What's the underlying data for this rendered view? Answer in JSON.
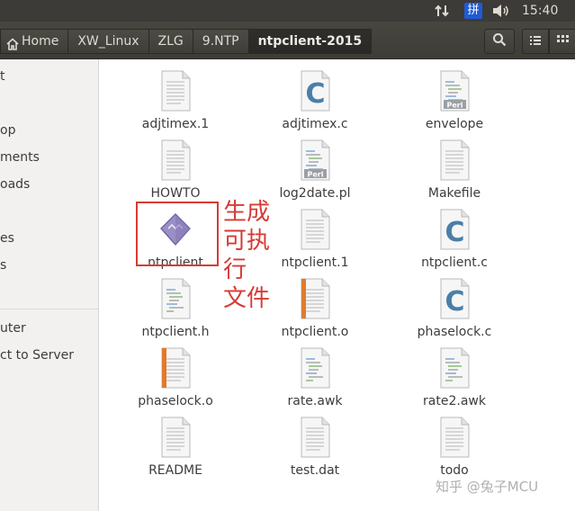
{
  "system_bar": {
    "keyboard_indicator": "拼",
    "time": "15:40"
  },
  "breadcrumb": {
    "items": [
      "Home",
      "XW_Linux",
      "ZLG",
      "9.NTP",
      "ntpclient-2015"
    ]
  },
  "sidebar": {
    "items": [
      "t",
      "op",
      "ments",
      "oads",
      "es",
      "s",
      "uter",
      "ct to Server"
    ]
  },
  "files": [
    {
      "name": "adjtimex.1",
      "type": "doc"
    },
    {
      "name": "adjtimex.c",
      "type": "c"
    },
    {
      "name": "envelope",
      "type": "perl"
    },
    {
      "name": "HOWTO",
      "type": "doc"
    },
    {
      "name": "log2date.pl",
      "type": "perl"
    },
    {
      "name": "Makefile",
      "type": "doc"
    },
    {
      "name": "ntpclient",
      "type": "exec"
    },
    {
      "name": "ntpclient.1",
      "type": "doc"
    },
    {
      "name": "ntpclient.c",
      "type": "c"
    },
    {
      "name": "ntpclient.h",
      "type": "header"
    },
    {
      "name": "ntpclient.o",
      "type": "object"
    },
    {
      "name": "phaselock.c",
      "type": "c"
    },
    {
      "name": "phaselock.o",
      "type": "object"
    },
    {
      "name": "rate.awk",
      "type": "script"
    },
    {
      "name": "rate2.awk",
      "type": "script"
    },
    {
      "name": "README",
      "type": "doc"
    },
    {
      "name": "test.dat",
      "type": "doc"
    },
    {
      "name": "todo",
      "type": "doc"
    }
  ],
  "annotation": {
    "text_line1": "生成",
    "text_line2": "可执行",
    "text_line3": "文件",
    "color": "#d63b36"
  },
  "watermark": "知乎 @兔子MCU",
  "colors": {
    "toolbar": "#3c3b37",
    "sidebar": "#f2f1f0",
    "c_icon": "#4a7fa8",
    "object_stripe": "#e07b2c"
  }
}
